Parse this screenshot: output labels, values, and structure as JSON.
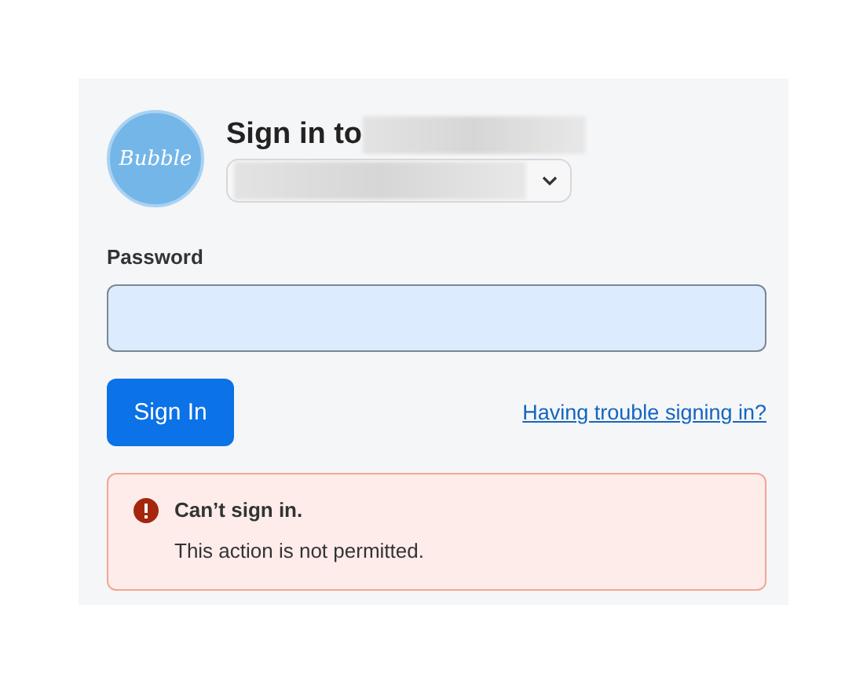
{
  "logo": {
    "text": "Bubble"
  },
  "header": {
    "title": "Sign in to"
  },
  "password": {
    "label": "Password"
  },
  "sign_in_button": "Sign In",
  "help_link": "Having trouble signing in?",
  "alert": {
    "title": "Can’t sign in.",
    "message": "This action is not permitted."
  }
}
